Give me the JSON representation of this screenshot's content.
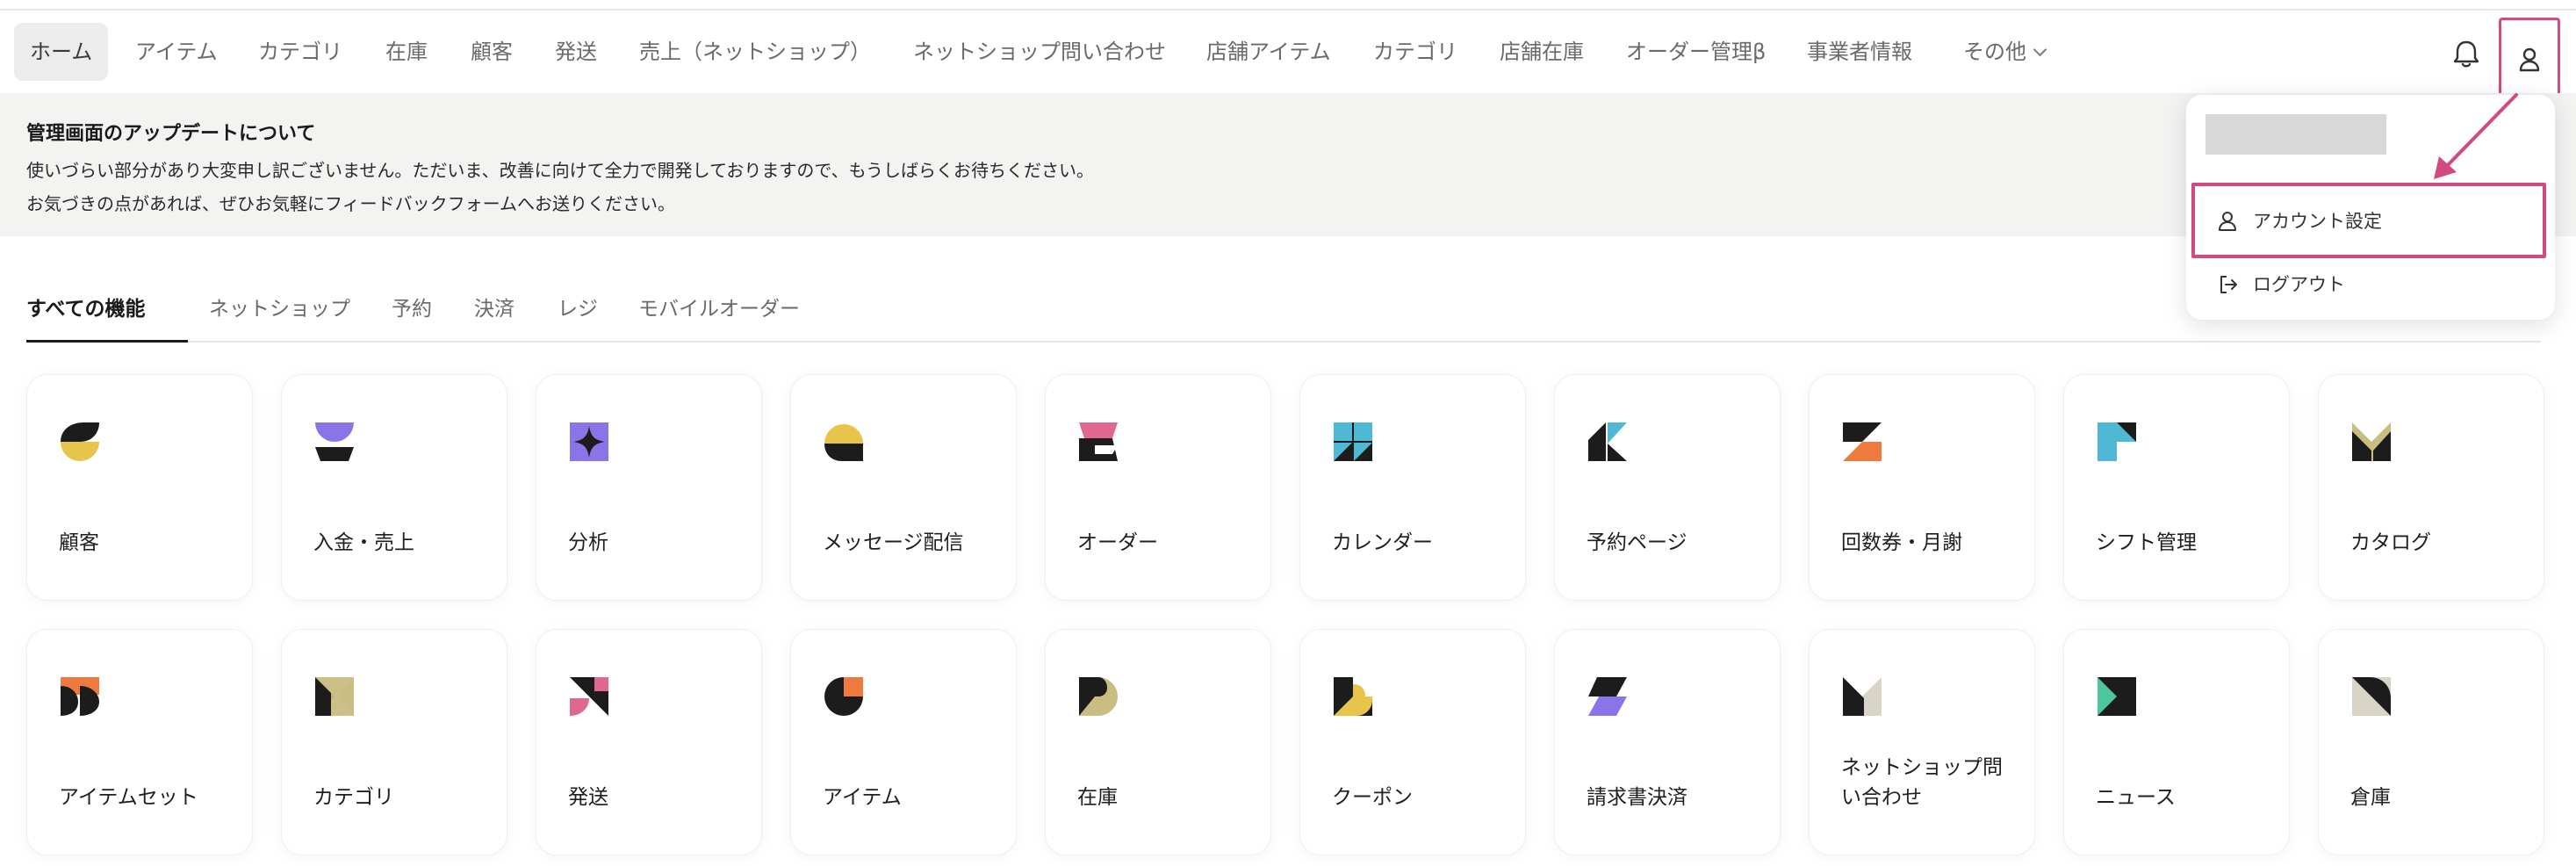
{
  "nav": {
    "items": [
      {
        "label": "ホーム",
        "active": true
      },
      {
        "label": "アイテム"
      },
      {
        "label": "カテゴリ"
      },
      {
        "label": "在庫"
      },
      {
        "label": "顧客"
      },
      {
        "label": "発送"
      },
      {
        "label": "売上（ネットショップ）"
      },
      {
        "label": "ネットショップ問い合わせ"
      },
      {
        "label": "店舗アイテム"
      },
      {
        "label": "カテゴリ"
      },
      {
        "label": "店舗在庫"
      },
      {
        "label": "オーダー管理β"
      },
      {
        "label": "事業者情報"
      },
      {
        "label": "その他"
      }
    ]
  },
  "notice": {
    "title": "管理画面のアップデートについて",
    "line1": "使いづらい部分があり大変申し訳ございません。ただいま、改善に向けて全力で開発しておりますので、もうしばらくお待ちください。",
    "line2": "お気づきの点があれば、ぜひお気軽にフィードバックフォームへお送りください。"
  },
  "tabs": [
    {
      "label": "すべての機能",
      "active": true
    },
    {
      "label": "ネットショップ"
    },
    {
      "label": "予約"
    },
    {
      "label": "決済"
    },
    {
      "label": "レジ"
    },
    {
      "label": "モバイルオーダー"
    }
  ],
  "cards_row1": [
    {
      "label": "顧客",
      "icon": "customer-icon"
    },
    {
      "label": "入金・売上",
      "icon": "payment-sales-icon"
    },
    {
      "label": "分析",
      "icon": "analytics-icon"
    },
    {
      "label": "メッセージ配信",
      "icon": "message-icon"
    },
    {
      "label": "オーダー",
      "icon": "order-icon"
    },
    {
      "label": "カレンダー",
      "icon": "calendar-icon"
    },
    {
      "label": "予約ページ",
      "icon": "reservation-page-icon"
    },
    {
      "label": "回数券・月謝",
      "icon": "ticket-icon"
    },
    {
      "label": "シフト管理",
      "icon": "shift-icon"
    },
    {
      "label": "カタログ",
      "icon": "catalog-icon"
    }
  ],
  "cards_row2": [
    {
      "label": "アイテムセット",
      "icon": "item-set-icon"
    },
    {
      "label": "カテゴリ",
      "icon": "category-icon"
    },
    {
      "label": "発送",
      "icon": "shipping-icon"
    },
    {
      "label": "アイテム",
      "icon": "item-icon"
    },
    {
      "label": "在庫",
      "icon": "stock-icon"
    },
    {
      "label": "クーポン",
      "icon": "coupon-icon"
    },
    {
      "label": "請求書決済",
      "icon": "invoice-icon"
    },
    {
      "label": "ネットショップ問い合わせ",
      "icon": "shop-inquiry-icon"
    },
    {
      "label": "ニュース",
      "icon": "news-icon"
    },
    {
      "label": "倉庫",
      "icon": "warehouse-icon"
    }
  ],
  "dropdown": {
    "account_settings": "アカウント設定",
    "logout": "ログアウト"
  },
  "colors": {
    "highlight": "#d24a82",
    "yellow": "#e8c44a",
    "purple": "#8b74e8",
    "pink": "#e0678f",
    "cyan": "#4fb8d4",
    "orange": "#ee7a3e",
    "olive": "#c9bd82",
    "green": "#4cc79b",
    "dark": "#1c1c1c"
  }
}
